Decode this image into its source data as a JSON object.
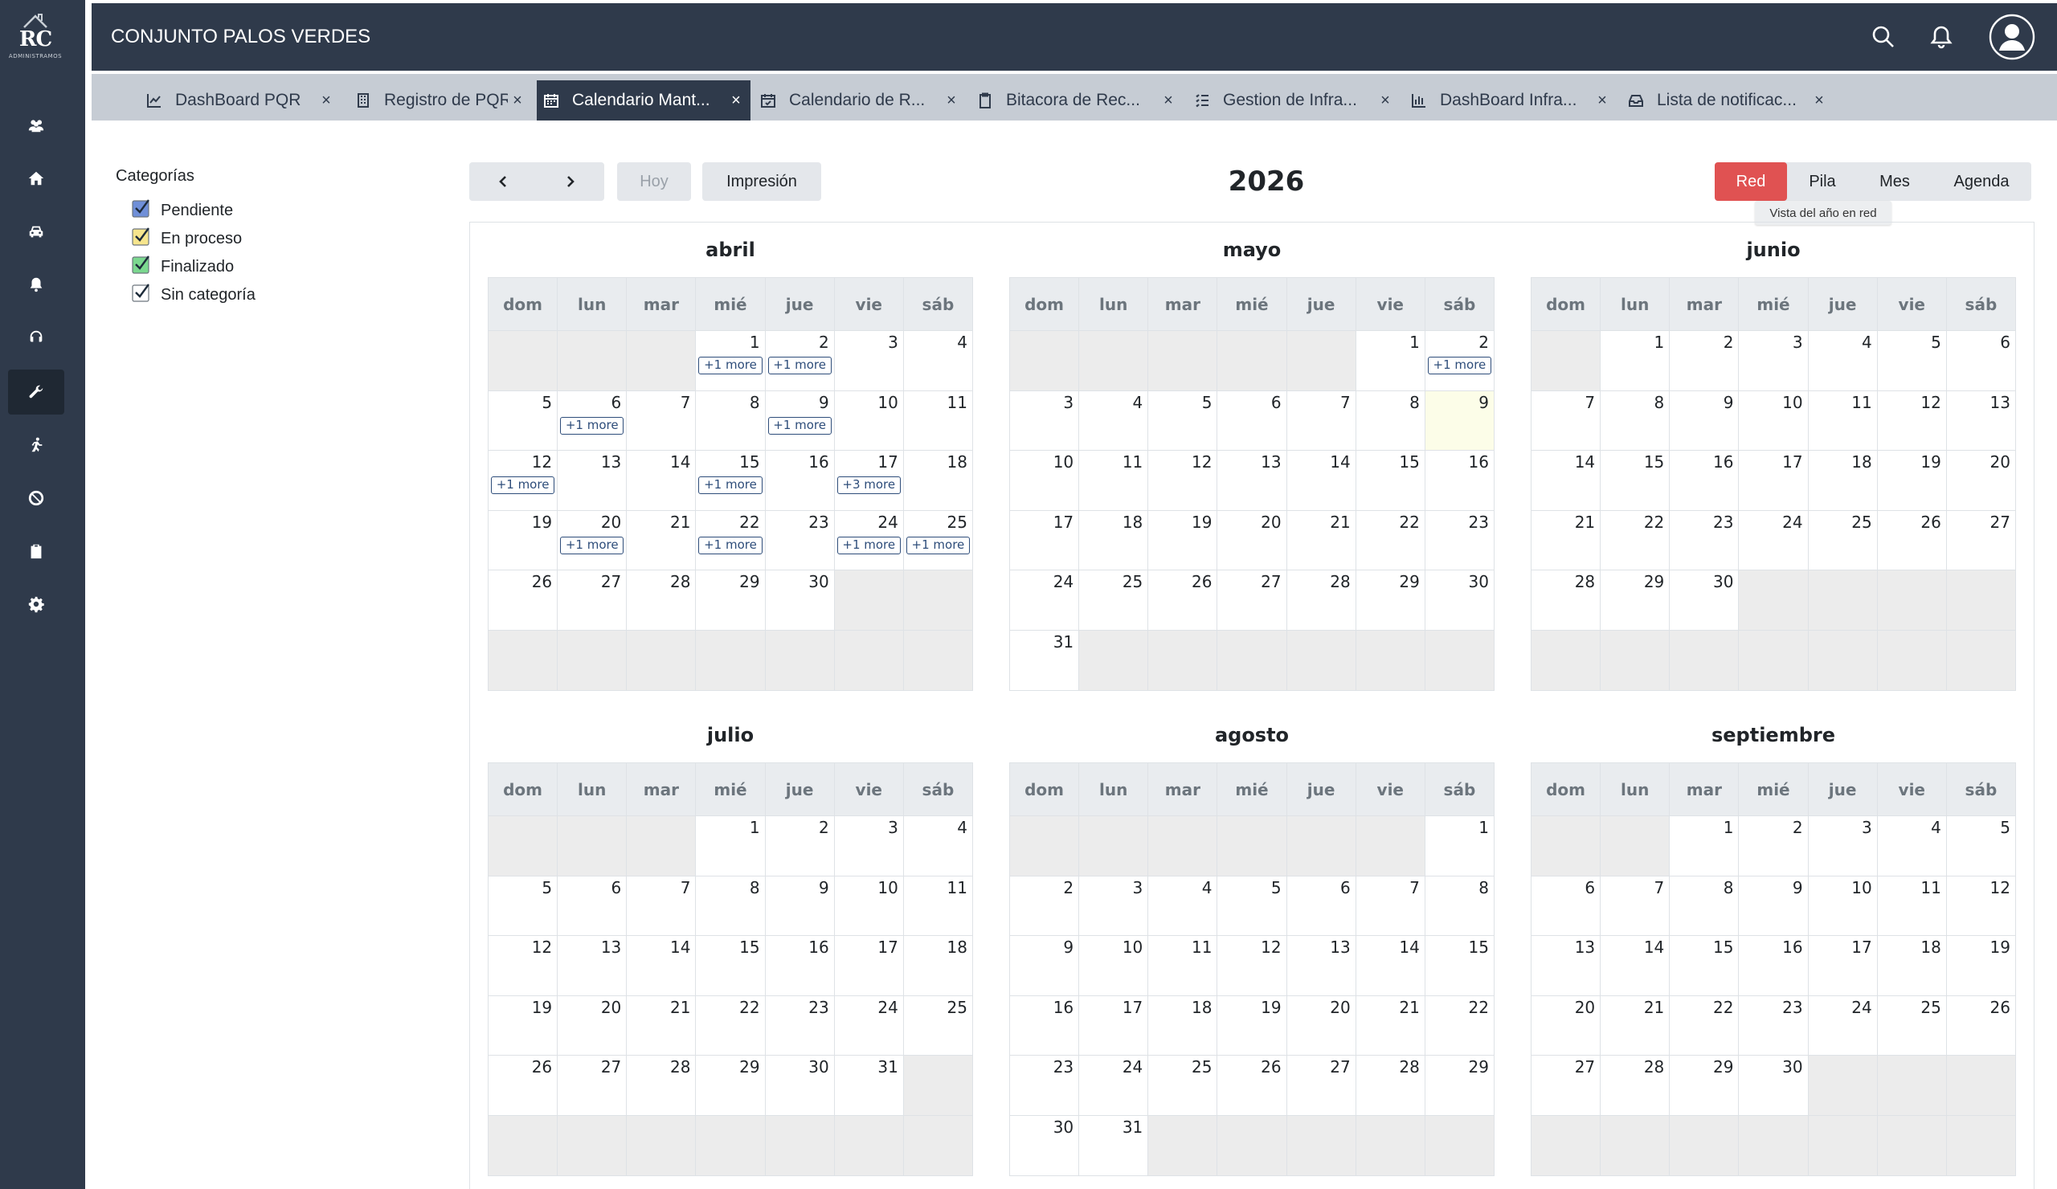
{
  "app": {
    "title": "CONJUNTO PALOS VERDES",
    "logo_text": "RC",
    "logo_subtext": "ADMINISTRAMOS"
  },
  "sidebar": {
    "items": [
      {
        "name": "users-icon",
        "active": false
      },
      {
        "name": "home-icon",
        "active": false
      },
      {
        "name": "car-icon",
        "active": false
      },
      {
        "name": "bell-icon",
        "active": false
      },
      {
        "name": "headset-icon",
        "active": false
      },
      {
        "name": "wrench-icon",
        "active": true
      },
      {
        "name": "running-icon",
        "active": false
      },
      {
        "name": "ban-icon",
        "active": false
      },
      {
        "name": "clipboard-check-icon",
        "active": false
      },
      {
        "name": "gear-icon",
        "active": false
      }
    ]
  },
  "header": {
    "icons": [
      "search-icon",
      "bell-icon",
      "user-avatar-icon"
    ]
  },
  "tabs": [
    {
      "label": "DashBoard PQR",
      "icon": "line-chart-icon",
      "active": false
    },
    {
      "label": "Registro de PQR",
      "icon": "building-icon",
      "active": false
    },
    {
      "label": "Calendario Mant...",
      "icon": "calendar-icon",
      "active": true
    },
    {
      "label": "Calendario de R...",
      "icon": "calendar-check-icon",
      "active": false
    },
    {
      "label": "Bitacora de Rec...",
      "icon": "clipboard-icon",
      "active": false
    },
    {
      "label": "Gestion de Infra...",
      "icon": "list-icon",
      "active": false
    },
    {
      "label": "DashBoard Infra...",
      "icon": "bar-chart-icon",
      "active": false
    },
    {
      "label": "Lista de notificac...",
      "icon": "inbox-icon",
      "active": false
    }
  ],
  "tab_close": "×",
  "categories": {
    "title": "Categorías",
    "items": [
      {
        "label": "Pendiente",
        "color": "#6f8fd8",
        "checked": true
      },
      {
        "label": "En proceso",
        "color": "#f6e58d",
        "checked": true
      },
      {
        "label": "Finalizado",
        "color": "#7bd88f",
        "checked": true
      },
      {
        "label": "Sin categoría",
        "color": "#ffffff",
        "checked": true
      }
    ]
  },
  "toolbar": {
    "today_label": "Hoy",
    "print_label": "Impresión",
    "year": "2026",
    "views": [
      {
        "label": "Red",
        "active": true
      },
      {
        "label": "Pila",
        "active": false
      },
      {
        "label": "Mes",
        "active": false
      },
      {
        "label": "Agenda",
        "active": false
      }
    ],
    "tooltip": "Vista del año en red"
  },
  "weekdays": [
    "dom",
    "lun",
    "mar",
    "mié",
    "jue",
    "vie",
    "sáb"
  ],
  "more_label": "+1 more",
  "months": [
    {
      "name": "abril",
      "start": 3,
      "days": 30,
      "more": {
        "1": "+1 more",
        "2": "+1 more",
        "6": "+1 more",
        "9": "+1 more",
        "12": "+1 more",
        "15": "+1 more",
        "17": "+3 more",
        "20": "+1 more",
        "22": "+1 more",
        "24": "+1 more",
        "25": "+1 more"
      },
      "today": null
    },
    {
      "name": "mayo",
      "start": 5,
      "days": 31,
      "more": {
        "2": "+1 more"
      },
      "today": 9
    },
    {
      "name": "junio",
      "start": 1,
      "days": 30,
      "more": {},
      "today": null
    },
    {
      "name": "julio",
      "start": 3,
      "days": 31,
      "more": {},
      "today": null
    },
    {
      "name": "agosto",
      "start": 6,
      "days": 31,
      "more": {},
      "today": null
    },
    {
      "name": "septiembre",
      "start": 2,
      "days": 30,
      "more": {},
      "today": null
    }
  ]
}
